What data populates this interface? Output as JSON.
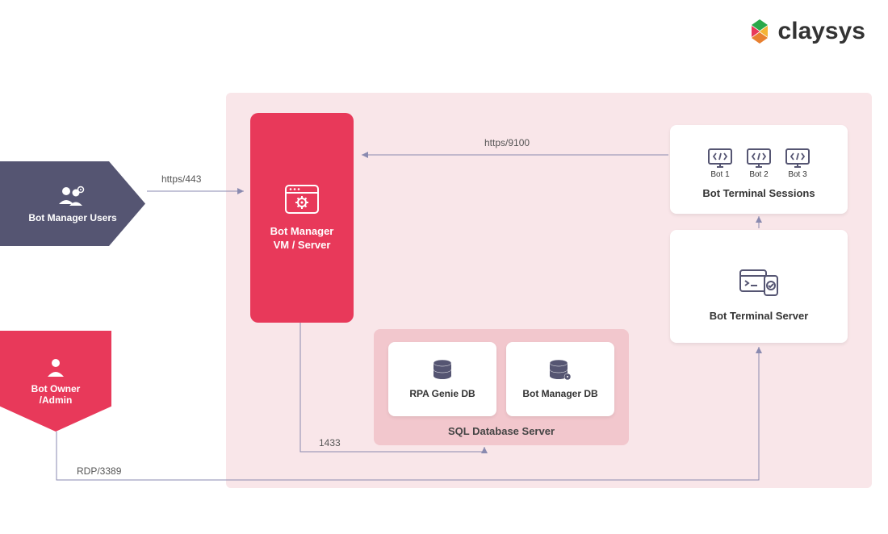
{
  "logo": {
    "text": "claysys"
  },
  "actors": {
    "manager_users": "Bot Manager Users",
    "owner_admin_line1": "Bot Owner",
    "owner_admin_line2": "/Admin"
  },
  "nodes": {
    "vm_line1": "Bot Manager",
    "vm_line2": "VM / Server",
    "sql_title": "SQL Database Server",
    "db_genie": "RPA Genie DB",
    "db_bm": "Bot Manager DB",
    "sessions_title": "Bot Terminal Sessions",
    "server_title": "Bot Terminal Server",
    "bot1": "Bot 1",
    "bot2": "Bot 2",
    "bot3": "Bot 3"
  },
  "arrows": {
    "https443": "https/443",
    "https9100": "https/9100",
    "port1433": "1433",
    "rdp3389": "RDP/3389"
  }
}
